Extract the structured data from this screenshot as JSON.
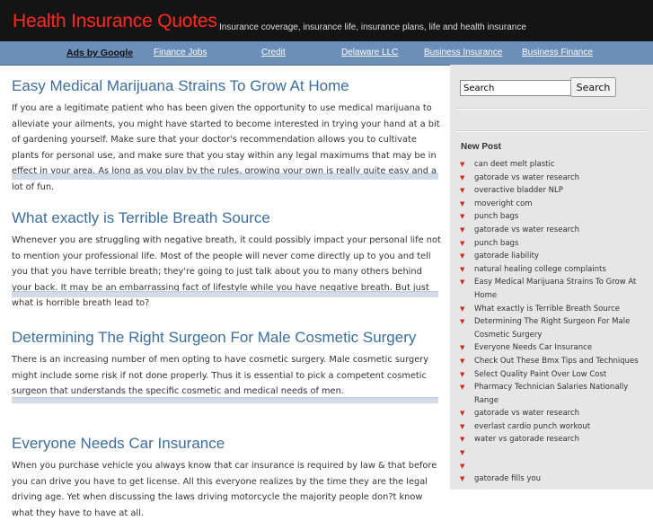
{
  "header": {
    "site_title": "Health Insurance Quotes",
    "tagline": "Insurance coverage, insurance life, insurance plans, life and health insurance"
  },
  "adbar": {
    "ads_label": "Ads by Google",
    "links": [
      "Finance Jobs",
      "Credit",
      "Delaware LLC",
      "Business Insurance",
      "Business Finance"
    ]
  },
  "posts": [
    {
      "title": "Easy Medical Marijuana Strains To Grow At Home",
      "excerpt": "If you are a legitimate patient who has been given the opportunity to use medical marijuana to alleviate your ailments, you might have started to become interested in trying your hand at a bit of gardening yourself. Make sure that your doctor's recommendation allows you to cultivate plants for personal use, and make sure that you stay within any legal maximums that may be in effect in your area. As long as you play by the rules, growing your own is really quite easy and a lot of fun."
    },
    {
      "title": "What exactly is Terrible Breath Source",
      "excerpt": "Whenever you are struggling with negative breath, it could possibly impact your personal life not to mention your professional life. Most of the people will never come directly up to you and tell you that you have terrible breath; they're going to just talk about you to many others behind your back. It may be an embarrassing fact of lifestyle while you have negative breath. But just what is horrible breath lead to?"
    },
    {
      "title": "Determining The Right Surgeon For Male Cosmetic Surgery",
      "excerpt": "There is an increasing number of men opting to have cosmetic surgery. Male cosmetic surgery might include some risk if not done properly. Thus it is essential to pick a competent cosmetic surgeon that understands the specific cosmetic and medical needs of men."
    },
    {
      "title": "Everyone Needs Car Insurance",
      "excerpt": "When you purchase vehicle you always know that car insurance is required by law & that before you can drive you have to get license. All this everyone realizes by the time they are the legal driving age. Yet when discussing the laws driving motorcycle the majority people don?t know what they have to have at all."
    }
  ],
  "sidebar": {
    "search_value": "Search",
    "search_button": "Search",
    "new_post_title": "New Post",
    "new_posts": [
      "can deet melt plastic",
      "gatorade vs water research",
      "overactive bladder NLP",
      "moveright com",
      "punch bags",
      "gatorade vs water research",
      "punch bags",
      "gatorade liability",
      "natural healing college complaints",
      "Easy Medical Marijuana Strains To Grow At Home",
      "What exactly is Terrible Breath Source",
      "Determining The Right Surgeon For Male Cosmetic Surgery",
      "Everyone Needs Car Insurance",
      "Check Out These Bmx Tips and Techniques",
      "Select Quality Paint Over Low Cost",
      "Pharmacy Technician Salaries Nationally Range",
      "gatorade vs water research",
      "everlast cardio punch workout",
      "water vs gatorade research",
      "",
      "",
      "gatorade fills you"
    ]
  },
  "colors": {
    "header_bg": "#141414",
    "title_red": "#ff2b22",
    "adbar_blue": "#6b8fb8",
    "post_title_blue": "#3c6e9e",
    "sidebar_bg": "#e6e6e6",
    "bullet_red": "#cc2a1a"
  },
  "icons": {
    "list_bullet": "red-chevron-bullet-icon"
  }
}
